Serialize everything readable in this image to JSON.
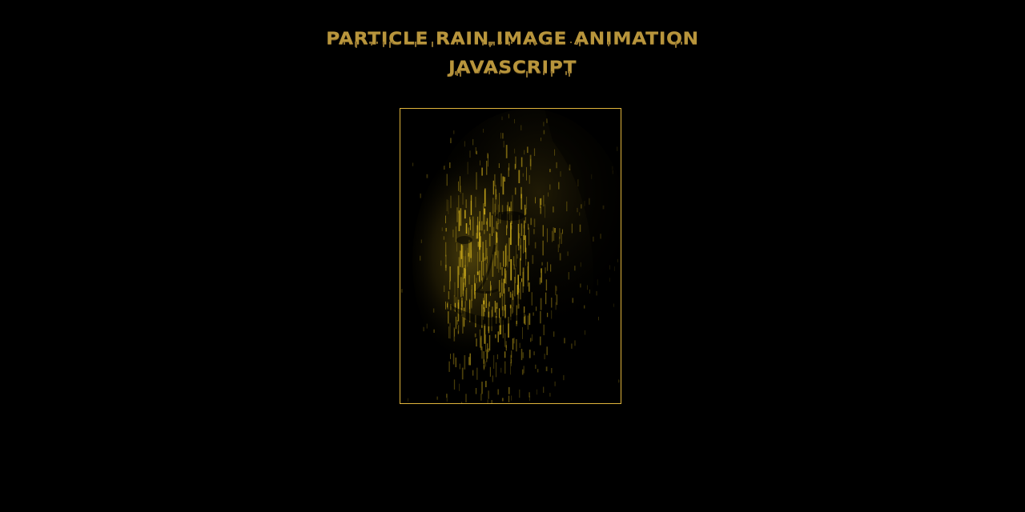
{
  "header": {
    "title_line1": "PARTICLE RAIN IMAGE ANIMATION",
    "title_line2": "JAVASCRIPT"
  },
  "canvas": {
    "subject": "particle-rain-portrait"
  },
  "colors": {
    "background": "#000000",
    "title": "#b8953c",
    "frame_border": "#e0b43c",
    "particle": "#d4b21c"
  }
}
